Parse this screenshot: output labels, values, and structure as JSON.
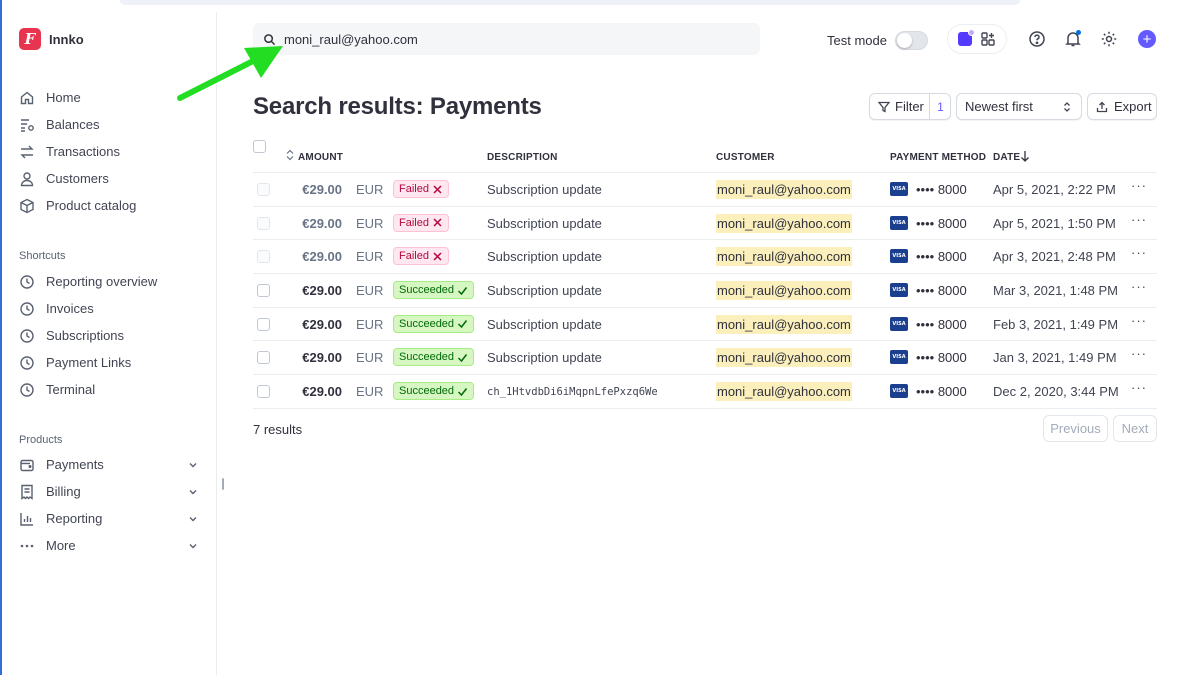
{
  "brand": {
    "name": "Innko",
    "logo_letter": "F",
    "color": "#e8344e"
  },
  "sidebar": {
    "main_items": [
      {
        "label": "Home",
        "icon": "home-icon"
      },
      {
        "label": "Balances",
        "icon": "balances-icon"
      },
      {
        "label": "Transactions",
        "icon": "transactions-icon"
      },
      {
        "label": "Customers",
        "icon": "customers-icon"
      },
      {
        "label": "Product catalog",
        "icon": "product-catalog-icon"
      }
    ],
    "shortcuts_label": "Shortcuts",
    "shortcuts": [
      {
        "label": "Reporting overview",
        "icon": "clock-icon"
      },
      {
        "label": "Invoices",
        "icon": "clock-icon"
      },
      {
        "label": "Subscriptions",
        "icon": "clock-icon"
      },
      {
        "label": "Payment Links",
        "icon": "clock-icon"
      },
      {
        "label": "Terminal",
        "icon": "clock-icon"
      }
    ],
    "products_label": "Products",
    "products": [
      {
        "label": "Payments",
        "icon": "wallet-icon"
      },
      {
        "label": "Billing",
        "icon": "billing-icon"
      },
      {
        "label": "Reporting",
        "icon": "reporting-icon"
      },
      {
        "label": "More",
        "icon": "ellipsis-icon"
      }
    ]
  },
  "header": {
    "search_value": "moni_raul@yahoo.com",
    "test_mode_label": "Test mode",
    "test_mode_on": false,
    "accent": "#635bff"
  },
  "page": {
    "title": "Search results: Payments",
    "filter_label": "Filter",
    "filter_count": "1",
    "sort_label": "Newest first",
    "export_label": "Export"
  },
  "table": {
    "columns": {
      "amount": "AMOUNT",
      "description": "DESCRIPTION",
      "customer": "CUSTOMER",
      "payment_method": "PAYMENT METHOD",
      "date": "DATE"
    },
    "rows": [
      {
        "amount": "€29.00",
        "currency": "EUR",
        "status": "Failed",
        "description": "Subscription update",
        "customer": "moni_raul@yahoo.com",
        "card_brand": "VISA",
        "last4": "•••• 8000",
        "date": "Apr 5, 2021, 2:22 PM"
      },
      {
        "amount": "€29.00",
        "currency": "EUR",
        "status": "Failed",
        "description": "Subscription update",
        "customer": "moni_raul@yahoo.com",
        "card_brand": "VISA",
        "last4": "•••• 8000",
        "date": "Apr 5, 2021, 1:50 PM"
      },
      {
        "amount": "€29.00",
        "currency": "EUR",
        "status": "Failed",
        "description": "Subscription update",
        "customer": "moni_raul@yahoo.com",
        "card_brand": "VISA",
        "last4": "•••• 8000",
        "date": "Apr 3, 2021, 2:48 PM"
      },
      {
        "amount": "€29.00",
        "currency": "EUR",
        "status": "Succeeded",
        "description": "Subscription update",
        "customer": "moni_raul@yahoo.com",
        "card_brand": "VISA",
        "last4": "•••• 8000",
        "date": "Mar 3, 2021, 1:48 PM"
      },
      {
        "amount": "€29.00",
        "currency": "EUR",
        "status": "Succeeded",
        "description": "Subscription update",
        "customer": "moni_raul@yahoo.com",
        "card_brand": "VISA",
        "last4": "•••• 8000",
        "date": "Feb 3, 2021, 1:49 PM"
      },
      {
        "amount": "€29.00",
        "currency": "EUR",
        "status": "Succeeded",
        "description": "Subscription update",
        "customer": "moni_raul@yahoo.com",
        "card_brand": "VISA",
        "last4": "•••• 8000",
        "date": "Jan 3, 2021, 1:49 PM"
      },
      {
        "amount": "€29.00",
        "currency": "EUR",
        "status": "Succeeded",
        "description": "ch_1HtvdbDi6iMqpnLfePxzq6We",
        "customer": "moni_raul@yahoo.com",
        "card_brand": "VISA",
        "last4": "•••• 8000",
        "date": "Dec 2, 2020, 3:44 PM"
      }
    ],
    "results_label": "7 results",
    "previous_label": "Previous",
    "next_label": "Next"
  },
  "annotation": {
    "arrow_color": "#22dd22"
  }
}
